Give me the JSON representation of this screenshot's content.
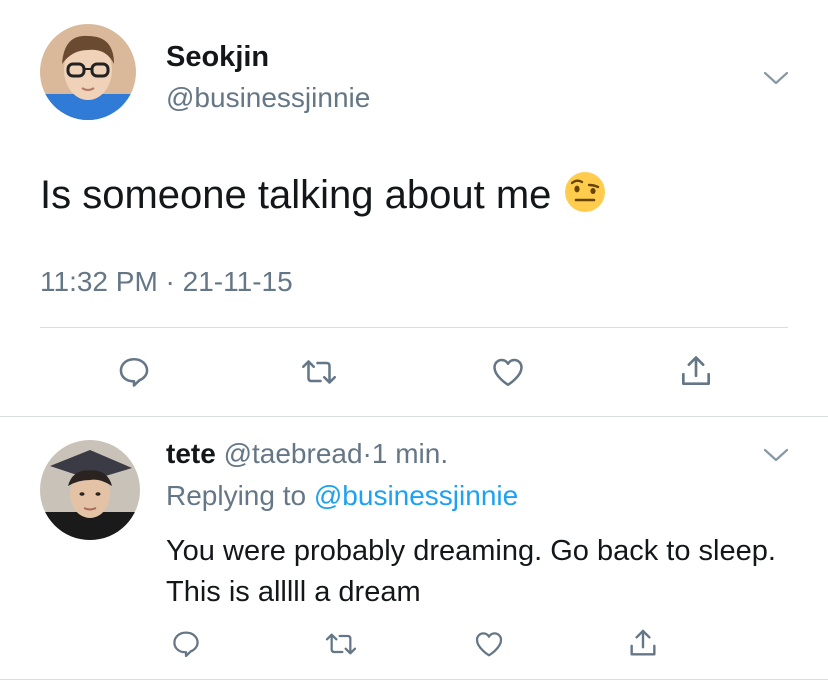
{
  "main_tweet": {
    "author": {
      "name": "Seokjin",
      "handle": "@businessjinnie"
    },
    "text": "Is someone talking about me",
    "emoji": "raised-eyebrow-emoji",
    "timestamp": "11:32 PM · 21-11-15",
    "actions": [
      "reply-icon",
      "retweet-icon",
      "like-icon",
      "share-icon"
    ]
  },
  "reply_tweet": {
    "author": {
      "name": "tete",
      "handle": "@taebread"
    },
    "separator": "·",
    "time": "1 min.",
    "replying_label": "Replying to",
    "replying_to": "@businessjinnie",
    "text": "You were probably dreaming. Go back to sleep. This is alllll a dream",
    "actions": [
      "reply-icon",
      "retweet-icon",
      "like-icon",
      "share-icon"
    ]
  },
  "colors": {
    "text": "#14171a",
    "secondary": "#657786",
    "link": "#1da1f2",
    "divider": "#d9dde0"
  }
}
